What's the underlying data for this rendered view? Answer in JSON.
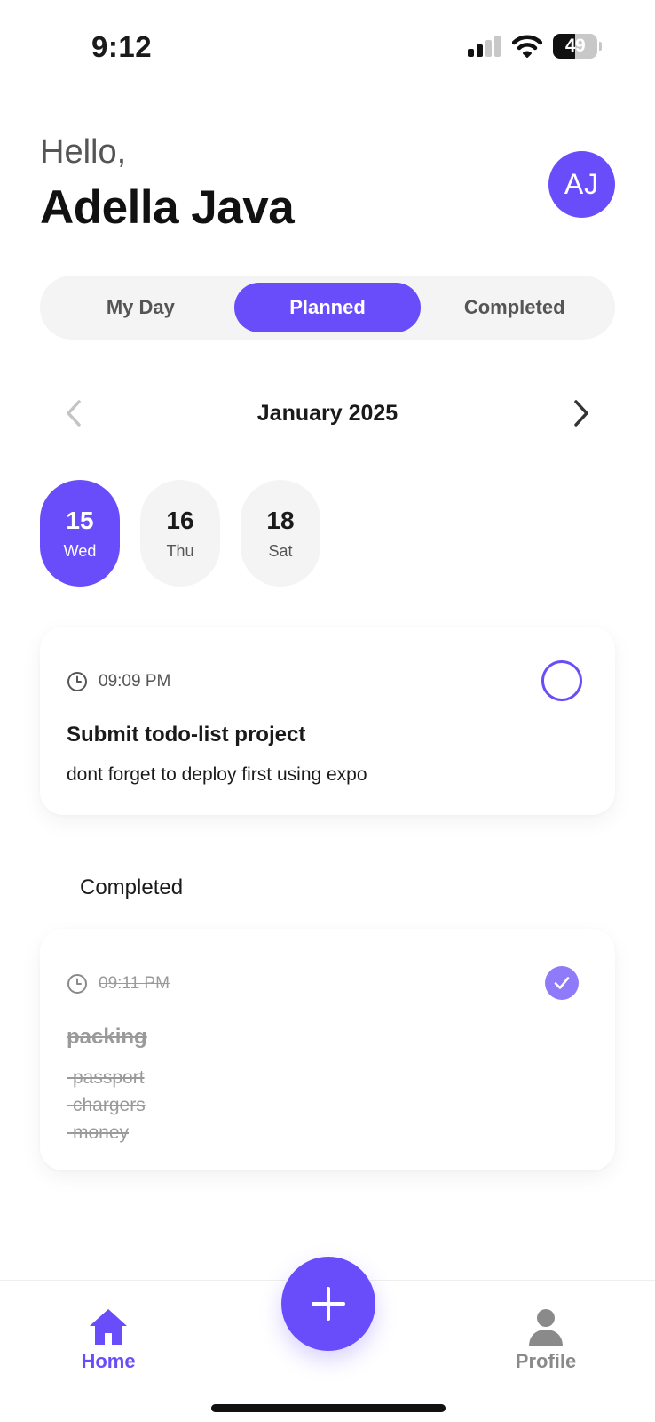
{
  "status_bar": {
    "time": "9:12",
    "battery_level": "49",
    "icons": [
      "cellular-signal-icon",
      "wifi-icon",
      "battery-icon"
    ]
  },
  "header": {
    "greeting": "Hello,",
    "user_name": "Adella Java",
    "avatar_initials": "AJ"
  },
  "tabs": [
    {
      "label": "My Day",
      "active": false
    },
    {
      "label": "Planned",
      "active": true
    },
    {
      "label": "Completed",
      "active": false
    }
  ],
  "calendar": {
    "month_label": "January 2025",
    "prev_icon": "chevron-left-icon",
    "next_icon": "chevron-right-icon",
    "dates": [
      {
        "day": "15",
        "weekday": "Wed",
        "selected": true
      },
      {
        "day": "16",
        "weekday": "Thu",
        "selected": false
      },
      {
        "day": "18",
        "weekday": "Sat",
        "selected": false
      }
    ]
  },
  "planned_tasks": [
    {
      "time": "09:09 PM",
      "title": "Submit todo-list project",
      "description": "dont forget to deploy first using expo",
      "completed": false
    }
  ],
  "completed_section": {
    "heading": "Completed",
    "tasks": [
      {
        "time": "09:11 PM",
        "title": "packing",
        "description": "-passport\n-chargers\n-money",
        "completed": true
      }
    ]
  },
  "bottom_nav": {
    "home_label": "Home",
    "profile_label": "Profile",
    "add_icon": "plus-icon"
  },
  "colors": {
    "accent": "#6a4dfa",
    "accent_light": "#8f7bfa",
    "pill_background": "#f4f4f4",
    "muted_text": "#555555",
    "inactive_icon": "#8a8a8a"
  }
}
